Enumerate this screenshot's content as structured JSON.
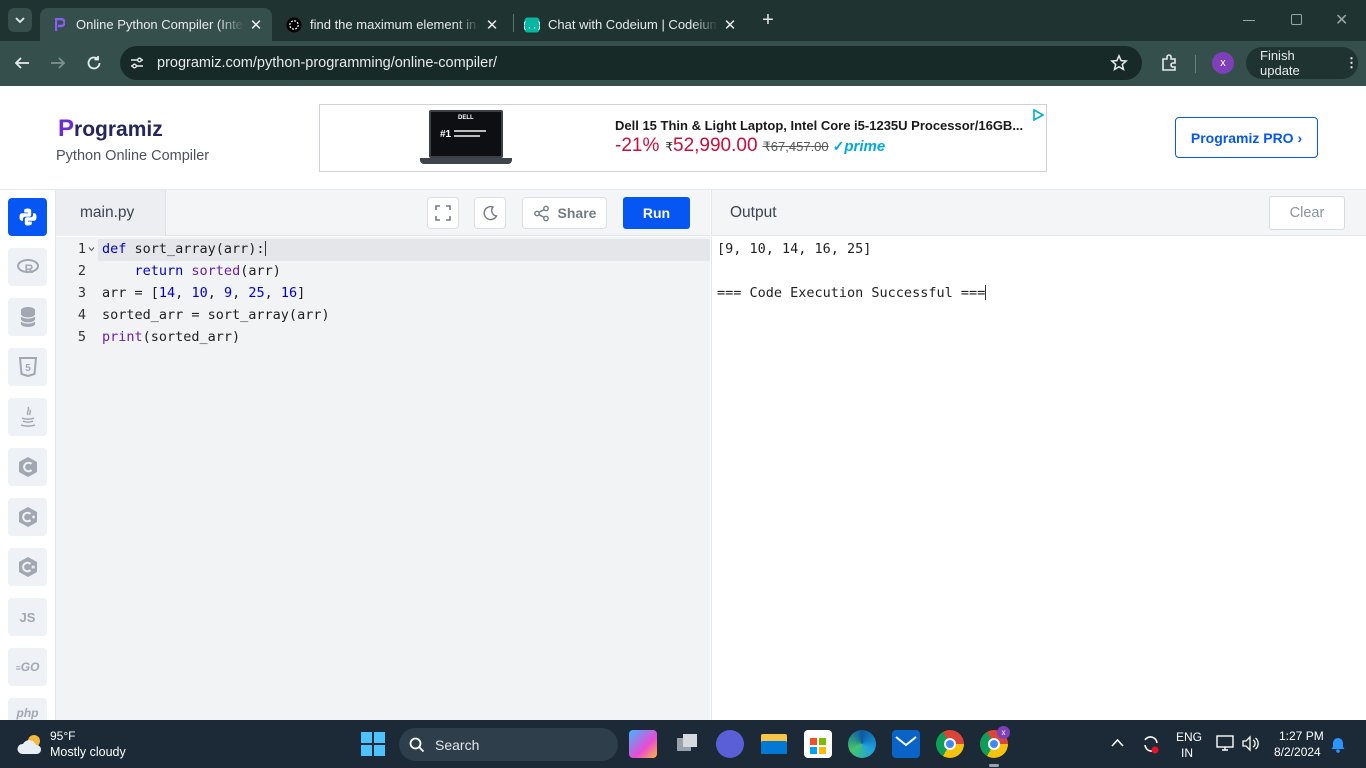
{
  "browser": {
    "tabs": [
      {
        "title": "Online Python Compiler (Interpreter)",
        "active": true
      },
      {
        "title": "find the maximum element in so",
        "active": false
      },
      {
        "title": "Chat with Codeium | Codeium",
        "active": false
      }
    ],
    "url": "programiz.com/python-programming/online-compiler/",
    "profile_initial": "x",
    "finish_update_label": "Finish update"
  },
  "site": {
    "logo_text": "rogramiz",
    "logo_initial": "P",
    "subtitle": "Python Online Compiler",
    "pro_button": "Programiz PRO ›"
  },
  "ad": {
    "title": "Dell 15 Thin & Light Laptop, Intel Core i5-1235U Processor/16GB...",
    "discount": "-21%",
    "price": "52,990.00",
    "currency": "₹",
    "old_price": "₹67,457.00",
    "prime": "prime",
    "image_badge": "#1",
    "image_brand": "DELL"
  },
  "editor": {
    "filename": "main.py",
    "share_label": "Share",
    "run_label": "Run",
    "lines": [
      {
        "num": "1"
      },
      {
        "num": "2"
      },
      {
        "num": "3"
      },
      {
        "num": "4"
      },
      {
        "num": "5"
      }
    ],
    "code": {
      "l1_def": "def",
      "l1_rest": " sort_array(arr):",
      "l2_indent": "    ",
      "l2_kw": "return",
      "l2_fn": " sorted",
      "l2_rest": "(arr)",
      "l3_pre": "arr = [",
      "l3_n1": "14",
      "l3_c1": ", ",
      "l3_n2": "10",
      "l3_c2": ", ",
      "l3_n3": "9",
      "l3_c3": ", ",
      "l3_n4": "25",
      "l3_c4": ", ",
      "l3_n5": "16",
      "l3_post": "]",
      "l4": "sorted_arr = sort_array(arr)",
      "l5_fn": "print",
      "l5_rest": "(sorted_arr)"
    }
  },
  "output": {
    "title": "Output",
    "clear_label": "Clear",
    "lines": [
      "[9, 10, 14, 16, 25]",
      "",
      "=== Code Execution Successful ==="
    ]
  },
  "sidebar": {
    "items": [
      {
        "label": "",
        "icon": "python-icon"
      },
      {
        "label": "R",
        "icon": "r-icon"
      },
      {
        "label": "",
        "icon": "database-icon"
      },
      {
        "label": "5",
        "icon": "html5-icon"
      },
      {
        "label": "",
        "icon": "java-icon"
      },
      {
        "label": "C",
        "icon": "c-icon"
      },
      {
        "label": "C",
        "icon": "cpp-icon"
      },
      {
        "label": "C",
        "icon": "csharp-icon"
      },
      {
        "label": "JS",
        "icon": "javascript-icon"
      },
      {
        "label": "GO",
        "icon": "go-icon"
      },
      {
        "label": "php",
        "icon": "php-icon"
      }
    ]
  },
  "taskbar": {
    "weather_temp": "95°F",
    "weather_desc": "Mostly cloudy",
    "search_label": "Search",
    "lang_line1": "ENG",
    "lang_line2": "IN",
    "time": "1:27 PM",
    "date": "8/2/2024"
  },
  "colors": {
    "accent": "#0556f3",
    "tabbar": "#1f3331",
    "toolbar": "#35504c",
    "taskbar": "#1b2a36"
  }
}
